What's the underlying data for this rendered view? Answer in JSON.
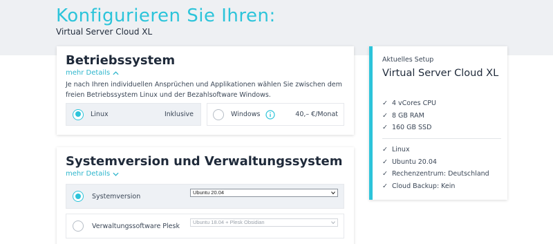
{
  "header": {
    "title": "Konfigurieren Sie Ihren:",
    "subtitle": "Virtual Server Cloud XL"
  },
  "os_card": {
    "title": "Betriebssystem",
    "more_label": "mehr Details",
    "description": "Je nach Ihren individuellen Ansprüchen und Applikationen wählen Sie zwischen dem freien Betriebssystem Linux und der Bezahlsoftware Windows.",
    "options": [
      {
        "label": "Linux",
        "price": "Inklusive",
        "selected": true
      },
      {
        "label": "Windows",
        "price": "40,– €/Monat",
        "selected": false,
        "info_icon": "info-icon"
      }
    ]
  },
  "system_card": {
    "title": "Systemversion und Verwaltungssystem",
    "more_label": "mehr Details",
    "rows": [
      {
        "label": "Systemversion",
        "select_value": "Ubuntu 20.04",
        "selected": true,
        "disabled": false
      },
      {
        "label": "Verwaltungssoftware Plesk",
        "select_value": "Ubuntu 18.04 + Plesk Obsidian",
        "selected": false,
        "disabled": true
      }
    ]
  },
  "setup": {
    "label": "Aktuelles Setup",
    "title": "Virtual Server Cloud XL",
    "specs": [
      "4 vCores CPU",
      "8 GB RAM",
      "160 GB SSD"
    ],
    "config": [
      "Linux",
      "Ubuntu 20.04",
      "Rechenzentrum: Deutschland",
      "Cloud Backup: Kein"
    ],
    "accent_color": "#2cc4da"
  }
}
